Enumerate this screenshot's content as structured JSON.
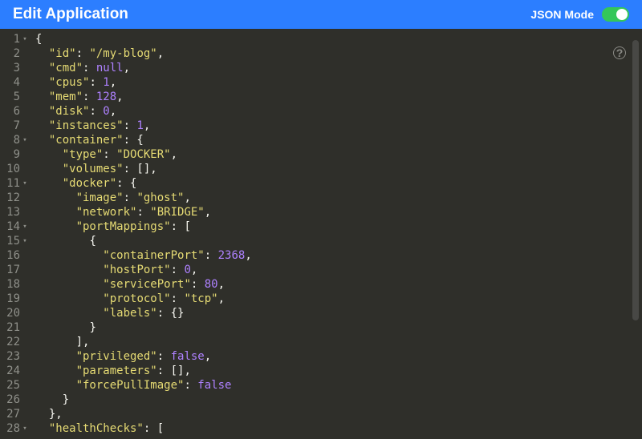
{
  "header": {
    "title": "Edit Application",
    "mode_label": "JSON Mode",
    "toggle_on": true
  },
  "help_icon_glyph": "?",
  "code_lines": [
    {
      "num": 1,
      "fold": "▾",
      "indent": 0,
      "tokens": [
        {
          "t": "pn",
          "v": "{"
        }
      ]
    },
    {
      "num": 2,
      "fold": "",
      "indent": 1,
      "tokens": [
        {
          "t": "key",
          "v": "\"id\""
        },
        {
          "t": "pn",
          "v": ": "
        },
        {
          "t": "str",
          "v": "\"/my-blog\""
        },
        {
          "t": "pn",
          "v": ","
        }
      ]
    },
    {
      "num": 3,
      "fold": "",
      "indent": 1,
      "tokens": [
        {
          "t": "key",
          "v": "\"cmd\""
        },
        {
          "t": "pn",
          "v": ": "
        },
        {
          "t": "null",
          "v": "null"
        },
        {
          "t": "pn",
          "v": ","
        }
      ]
    },
    {
      "num": 4,
      "fold": "",
      "indent": 1,
      "tokens": [
        {
          "t": "key",
          "v": "\"cpus\""
        },
        {
          "t": "pn",
          "v": ": "
        },
        {
          "t": "num",
          "v": "1"
        },
        {
          "t": "pn",
          "v": ","
        }
      ]
    },
    {
      "num": 5,
      "fold": "",
      "indent": 1,
      "tokens": [
        {
          "t": "key",
          "v": "\"mem\""
        },
        {
          "t": "pn",
          "v": ": "
        },
        {
          "t": "num",
          "v": "128"
        },
        {
          "t": "pn",
          "v": ","
        }
      ]
    },
    {
      "num": 6,
      "fold": "",
      "indent": 1,
      "tokens": [
        {
          "t": "key",
          "v": "\"disk\""
        },
        {
          "t": "pn",
          "v": ": "
        },
        {
          "t": "num",
          "v": "0"
        },
        {
          "t": "pn",
          "v": ","
        }
      ]
    },
    {
      "num": 7,
      "fold": "",
      "indent": 1,
      "tokens": [
        {
          "t": "key",
          "v": "\"instances\""
        },
        {
          "t": "pn",
          "v": ": "
        },
        {
          "t": "num",
          "v": "1"
        },
        {
          "t": "pn",
          "v": ","
        }
      ]
    },
    {
      "num": 8,
      "fold": "▾",
      "indent": 1,
      "tokens": [
        {
          "t": "key",
          "v": "\"container\""
        },
        {
          "t": "pn",
          "v": ": {"
        }
      ]
    },
    {
      "num": 9,
      "fold": "",
      "indent": 2,
      "tokens": [
        {
          "t": "key",
          "v": "\"type\""
        },
        {
          "t": "pn",
          "v": ": "
        },
        {
          "t": "str",
          "v": "\"DOCKER\""
        },
        {
          "t": "pn",
          "v": ","
        }
      ]
    },
    {
      "num": 10,
      "fold": "",
      "indent": 2,
      "tokens": [
        {
          "t": "key",
          "v": "\"volumes\""
        },
        {
          "t": "pn",
          "v": ": [],"
        }
      ]
    },
    {
      "num": 11,
      "fold": "▾",
      "indent": 2,
      "tokens": [
        {
          "t": "key",
          "v": "\"docker\""
        },
        {
          "t": "pn",
          "v": ": {"
        }
      ]
    },
    {
      "num": 12,
      "fold": "",
      "indent": 3,
      "tokens": [
        {
          "t": "key",
          "v": "\"image\""
        },
        {
          "t": "pn",
          "v": ": "
        },
        {
          "t": "str",
          "v": "\"ghost\""
        },
        {
          "t": "pn",
          "v": ","
        }
      ]
    },
    {
      "num": 13,
      "fold": "",
      "indent": 3,
      "tokens": [
        {
          "t": "key",
          "v": "\"network\""
        },
        {
          "t": "pn",
          "v": ": "
        },
        {
          "t": "str",
          "v": "\"BRIDGE\""
        },
        {
          "t": "pn",
          "v": ","
        }
      ]
    },
    {
      "num": 14,
      "fold": "▾",
      "indent": 3,
      "tokens": [
        {
          "t": "key",
          "v": "\"portMappings\""
        },
        {
          "t": "pn",
          "v": ": ["
        }
      ]
    },
    {
      "num": 15,
      "fold": "▾",
      "indent": 4,
      "tokens": [
        {
          "t": "pn",
          "v": "{"
        }
      ]
    },
    {
      "num": 16,
      "fold": "",
      "indent": 5,
      "tokens": [
        {
          "t": "key",
          "v": "\"containerPort\""
        },
        {
          "t": "pn",
          "v": ": "
        },
        {
          "t": "num",
          "v": "2368"
        },
        {
          "t": "pn",
          "v": ","
        }
      ]
    },
    {
      "num": 17,
      "fold": "",
      "indent": 5,
      "tokens": [
        {
          "t": "key",
          "v": "\"hostPort\""
        },
        {
          "t": "pn",
          "v": ": "
        },
        {
          "t": "num",
          "v": "0"
        },
        {
          "t": "pn",
          "v": ","
        }
      ]
    },
    {
      "num": 18,
      "fold": "",
      "indent": 5,
      "tokens": [
        {
          "t": "key",
          "v": "\"servicePort\""
        },
        {
          "t": "pn",
          "v": ": "
        },
        {
          "t": "num",
          "v": "80"
        },
        {
          "t": "pn",
          "v": ","
        }
      ]
    },
    {
      "num": 19,
      "fold": "",
      "indent": 5,
      "tokens": [
        {
          "t": "key",
          "v": "\"protocol\""
        },
        {
          "t": "pn",
          "v": ": "
        },
        {
          "t": "str",
          "v": "\"tcp\""
        },
        {
          "t": "pn",
          "v": ","
        }
      ]
    },
    {
      "num": 20,
      "fold": "",
      "indent": 5,
      "tokens": [
        {
          "t": "key",
          "v": "\"labels\""
        },
        {
          "t": "pn",
          "v": ": {}"
        }
      ]
    },
    {
      "num": 21,
      "fold": "",
      "indent": 4,
      "tokens": [
        {
          "t": "pn",
          "v": "}"
        }
      ]
    },
    {
      "num": 22,
      "fold": "",
      "indent": 3,
      "tokens": [
        {
          "t": "pn",
          "v": "],"
        }
      ]
    },
    {
      "num": 23,
      "fold": "",
      "indent": 3,
      "tokens": [
        {
          "t": "key",
          "v": "\"privileged\""
        },
        {
          "t": "pn",
          "v": ": "
        },
        {
          "t": "bool",
          "v": "false"
        },
        {
          "t": "pn",
          "v": ","
        }
      ]
    },
    {
      "num": 24,
      "fold": "",
      "indent": 3,
      "tokens": [
        {
          "t": "key",
          "v": "\"parameters\""
        },
        {
          "t": "pn",
          "v": ": [],"
        }
      ]
    },
    {
      "num": 25,
      "fold": "",
      "indent": 3,
      "tokens": [
        {
          "t": "key",
          "v": "\"forcePullImage\""
        },
        {
          "t": "pn",
          "v": ": "
        },
        {
          "t": "bool",
          "v": "false"
        }
      ]
    },
    {
      "num": 26,
      "fold": "",
      "indent": 2,
      "tokens": [
        {
          "t": "pn",
          "v": "}"
        }
      ]
    },
    {
      "num": 27,
      "fold": "",
      "indent": 1,
      "tokens": [
        {
          "t": "pn",
          "v": "},"
        }
      ]
    },
    {
      "num": 28,
      "fold": "▾",
      "indent": 1,
      "tokens": [
        {
          "t": "key",
          "v": "\"healthChecks\""
        },
        {
          "t": "pn",
          "v": ": ["
        }
      ]
    }
  ]
}
